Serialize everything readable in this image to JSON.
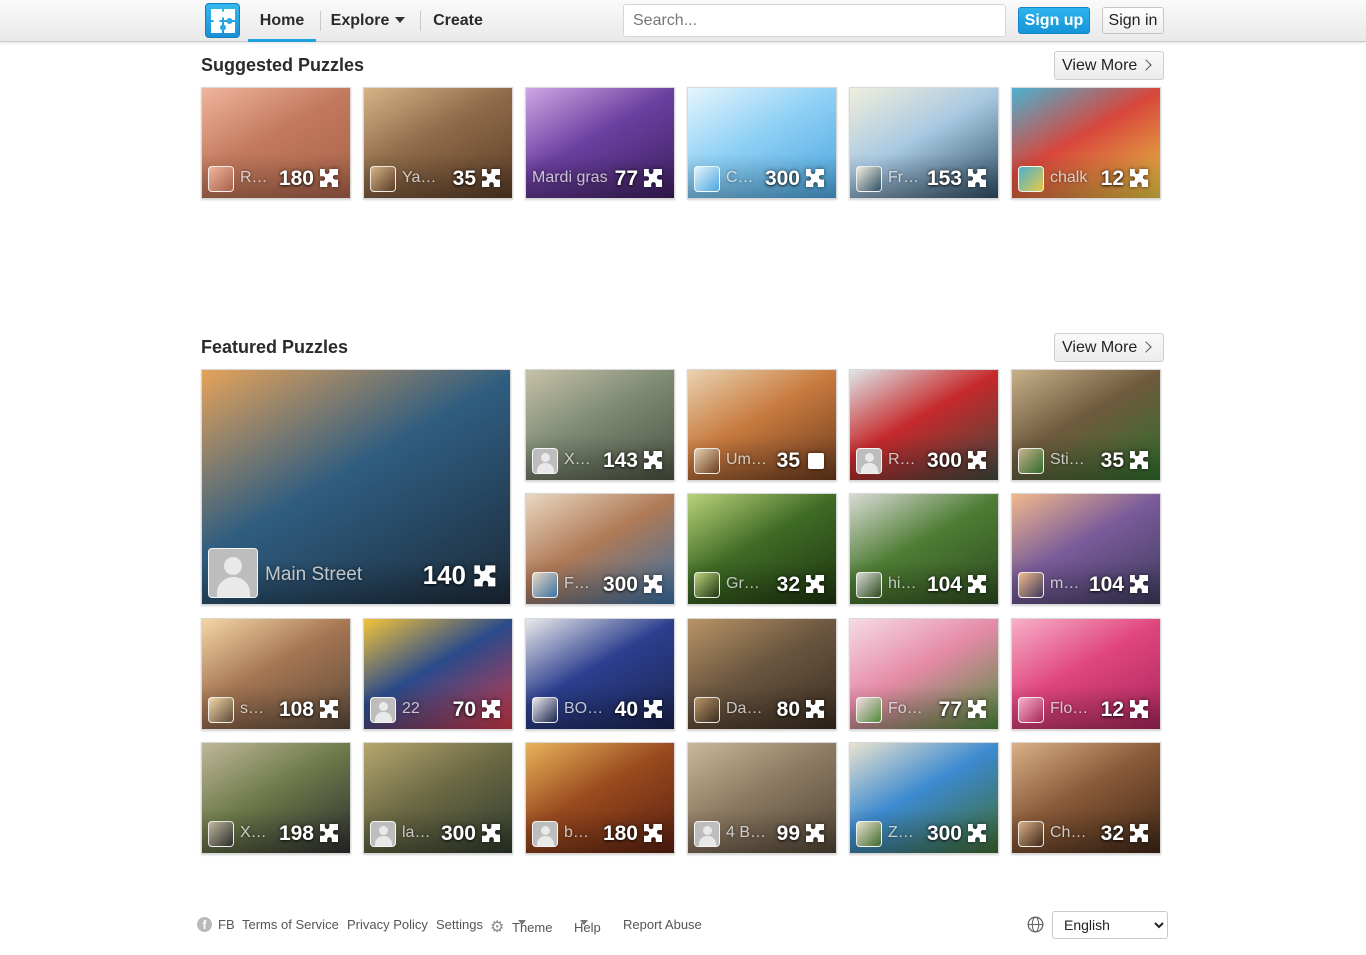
{
  "header": {
    "nav": {
      "home": "Home",
      "explore": "Explore",
      "create": "Create"
    },
    "search_placeholder": "Search...",
    "signup": "Sign up",
    "signin": "Sign in"
  },
  "suggested": {
    "title": "Suggested Puzzles",
    "view_more": "View More",
    "tiles": [
      {
        "title": "R…",
        "count": "180",
        "avatar": "photo",
        "colors": [
          "#c2795d",
          "#efb59c",
          "#a86248"
        ]
      },
      {
        "title": "Yay…",
        "count": "35",
        "avatar": "photo",
        "colors": [
          "#8d6a48",
          "#d6b487",
          "#5a3b26"
        ]
      },
      {
        "title": "Mardi gras",
        "count": "77",
        "avatar": "none",
        "colors": [
          "#6b3fa0",
          "#cfa7e4",
          "#3e2060"
        ]
      },
      {
        "title": "C…",
        "count": "300",
        "avatar": "photo",
        "colors": [
          "#8ed0f5",
          "#e5f5fd",
          "#4aa5de"
        ]
      },
      {
        "title": "Fr…",
        "count": "153",
        "avatar": "photo",
        "colors": [
          "#a9c9e2",
          "#f0eedb",
          "#2f4f66"
        ]
      },
      {
        "title": "chalk",
        "count": "12",
        "avatar": "photo",
        "colors": [
          "#d8463c",
          "#4bb2d1",
          "#e7c843"
        ]
      }
    ]
  },
  "featured": {
    "title": "Featured Puzzles",
    "view_more": "View More",
    "big": {
      "title": "Main Street",
      "count": "140",
      "avatar": "gray",
      "colors": [
        "#2f5d80",
        "#e6a35a",
        "#1c2a39"
      ]
    },
    "tiles": [
      {
        "title": "X…",
        "count": "143",
        "avatar": "gray",
        "colors": [
          "#7e8a74",
          "#c6c2a8",
          "#4a5240"
        ]
      },
      {
        "title": "Um…",
        "count": "35",
        "avatar": "photo",
        "colors": [
          "#c87a3e",
          "#e9d2b0",
          "#6b3a1e"
        ],
        "icon": "square"
      },
      {
        "title": "R…",
        "count": "300",
        "avatar": "gray",
        "colors": [
          "#c6292b",
          "#dfe5e8",
          "#3e4a3e"
        ]
      },
      {
        "title": "Sti…",
        "count": "35",
        "avatar": "photo",
        "colors": [
          "#6f5a3e",
          "#c7b08a",
          "#2f6d2c"
        ]
      },
      {
        "title": "F…",
        "count": "300",
        "avatar": "photo",
        "colors": [
          "#b07a56",
          "#e8d8c2",
          "#3a70a5"
        ]
      },
      {
        "title": "Gre…",
        "count": "32",
        "avatar": "photo",
        "colors": [
          "#3f6b25",
          "#b9d27a",
          "#1e3510"
        ]
      },
      {
        "title": "hi…",
        "count": "104",
        "avatar": "photo",
        "colors": [
          "#4e7d34",
          "#d9dbd5",
          "#2d4a1f"
        ]
      },
      {
        "title": "m…",
        "count": "104",
        "avatar": "photo",
        "colors": [
          "#7a5b9a",
          "#f1b98c",
          "#3d3b5c"
        ]
      },
      {
        "title": "s…",
        "count": "108",
        "avatar": "photo",
        "colors": [
          "#a57552",
          "#f4d6a6",
          "#5b4a3a"
        ]
      },
      {
        "title": "22",
        "count": "70",
        "avatar": "gray",
        "colors": [
          "#2a4a8a",
          "#f3c43a",
          "#d2394a"
        ]
      },
      {
        "title": "BO…",
        "count": "40",
        "avatar": "photo",
        "colors": [
          "#2c3f8f",
          "#e9e9ea",
          "#1a2450"
        ]
      },
      {
        "title": "Da…",
        "count": "80",
        "avatar": "photo",
        "colors": [
          "#6b5640",
          "#b89466",
          "#3a2c20"
        ]
      },
      {
        "title": "Fo…",
        "count": "77",
        "avatar": "photo",
        "colors": [
          "#e58aa7",
          "#f6dbe4",
          "#4e8a3a"
        ]
      },
      {
        "title": "Flo…",
        "count": "12",
        "avatar": "photo",
        "colors": [
          "#e0457d",
          "#f7b0c9",
          "#a8265a"
        ]
      },
      {
        "title": "X…",
        "count": "198",
        "avatar": "photo",
        "colors": [
          "#6d7a4a",
          "#bfb79a",
          "#2c2e2e"
        ]
      },
      {
        "title": "la…",
        "count": "300",
        "avatar": "gray",
        "colors": [
          "#6c6a45",
          "#b6a66e",
          "#2f3a2c"
        ]
      },
      {
        "title": "b…",
        "count": "180",
        "avatar": "gray",
        "colors": [
          "#9a4a1e",
          "#e8b35a",
          "#5a2010"
        ]
      },
      {
        "title": "4 B…",
        "count": "99",
        "avatar": "gray",
        "colors": [
          "#8d7a62",
          "#c9b89b",
          "#4f4435"
        ]
      },
      {
        "title": "Z…",
        "count": "300",
        "avatar": "photo",
        "colors": [
          "#3c8ad0",
          "#e9e3cf",
          "#3f6a2e"
        ]
      },
      {
        "title": "Ch…",
        "count": "32",
        "avatar": "photo",
        "colors": [
          "#8a5a38",
          "#d9b087",
          "#3e2616"
        ]
      }
    ]
  },
  "footer": {
    "fb": "FB",
    "terms": "Terms of Service",
    "privacy": "Privacy Policy",
    "settings": "Settings",
    "theme": "Theme",
    "help": "Help",
    "report": "Report Abuse",
    "language": "English"
  },
  "colors": {
    "accent": "#1fa3e0",
    "signup": "#1595d8"
  }
}
